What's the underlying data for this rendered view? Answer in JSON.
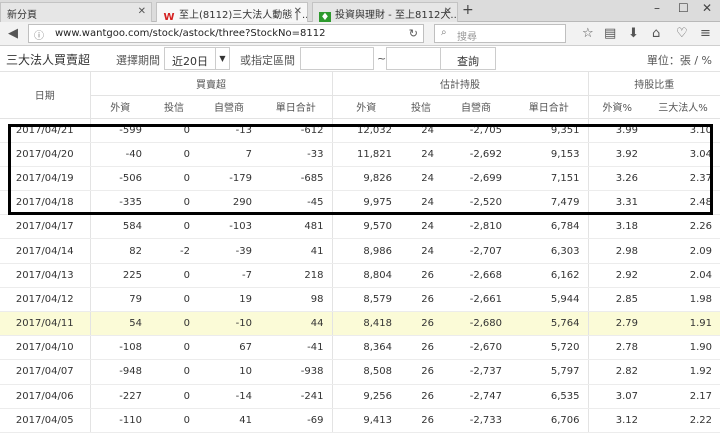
{
  "browser": {
    "tabs": [
      {
        "title": "新分頁",
        "active": false
      },
      {
        "title": "至上(8112)三大法人動態 | ...",
        "active": true
      },
      {
        "title": "投資與理財 - 至上8112大...",
        "active": false
      }
    ],
    "new_tab": "+",
    "url": "www.wantgoo.com/stock/astock/three?StockNo=8112",
    "search_placeholder": "搜尋"
  },
  "filter": {
    "page_title": "三大法人買賣超",
    "period_label": "選擇期間",
    "period_value": "近20日",
    "range_label": "或指定區間",
    "range_sep": "~",
    "query_button": "查詢",
    "unit": "單位：張 / %"
  },
  "table": {
    "date_header": "日期",
    "group_headers": [
      "買賣超",
      "估計持股",
      "持股比重"
    ],
    "sub_headers": [
      "外資",
      "投信",
      "自營商",
      "單日合計",
      "外資",
      "投信",
      "自營商",
      "單日合計",
      "外資%",
      "三大法人%"
    ],
    "rows": [
      {
        "date": "2017/04/21",
        "v": [
          "-599",
          "0",
          "-13",
          "-612",
          "12,032",
          "24",
          "-2,705",
          "9,351",
          "3.99",
          "3.10"
        ],
        "trend": "neg"
      },
      {
        "date": "2017/04/20",
        "v": [
          "-40",
          "0",
          "7",
          "-33",
          "11,821",
          "24",
          "-2,692",
          "9,153",
          "3.92",
          "3.04"
        ],
        "trend": "neg"
      },
      {
        "date": "2017/04/19",
        "v": [
          "-506",
          "0",
          "-179",
          "-685",
          "9,826",
          "24",
          "-2,699",
          "7,151",
          "3.26",
          "2.37"
        ],
        "trend": "neg"
      },
      {
        "date": "2017/04/18",
        "v": [
          "-335",
          "0",
          "290",
          "-45",
          "9,975",
          "24",
          "-2,520",
          "7,479",
          "3.31",
          "2.48"
        ],
        "trend": "neg"
      },
      {
        "date": "2017/04/17",
        "v": [
          "584",
          "0",
          "-103",
          "481",
          "9,570",
          "24",
          "-2,810",
          "6,784",
          "3.18",
          "2.26"
        ],
        "trend": "pos"
      },
      {
        "date": "2017/04/14",
        "v": [
          "82",
          "-2",
          "-39",
          "41",
          "8,986",
          "24",
          "-2,707",
          "6,303",
          "2.98",
          "2.09"
        ],
        "trend": "pos"
      },
      {
        "date": "2017/04/13",
        "v": [
          "225",
          "0",
          "-7",
          "218",
          "8,804",
          "26",
          "-2,668",
          "6,162",
          "2.92",
          "2.04"
        ],
        "trend": "pos"
      },
      {
        "date": "2017/04/12",
        "v": [
          "79",
          "0",
          "19",
          "98",
          "8,579",
          "26",
          "-2,661",
          "5,944",
          "2.85",
          "1.98"
        ],
        "trend": "pos"
      },
      {
        "date": "2017/04/11",
        "v": [
          "54",
          "0",
          "-10",
          "44",
          "8,418",
          "26",
          "-2,680",
          "5,764",
          "2.79",
          "1.91"
        ],
        "trend": "pos",
        "highlight": true
      },
      {
        "date": "2017/04/10",
        "v": [
          "-108",
          "0",
          "67",
          "-41",
          "8,364",
          "26",
          "-2,670",
          "5,720",
          "2.78",
          "1.90"
        ],
        "trend": "neg"
      },
      {
        "date": "2017/04/07",
        "v": [
          "-948",
          "0",
          "10",
          "-938",
          "8,508",
          "26",
          "-2,737",
          "5,797",
          "2.82",
          "1.92"
        ],
        "trend": "neg"
      },
      {
        "date": "2017/04/06",
        "v": [
          "-227",
          "0",
          "-14",
          "-241",
          "9,256",
          "26",
          "-2,747",
          "6,535",
          "3.07",
          "2.17"
        ],
        "trend": "neg"
      },
      {
        "date": "2017/04/05",
        "v": [
          "-110",
          "0",
          "41",
          "-69",
          "9,413",
          "26",
          "-2,733",
          "6,706",
          "3.12",
          "2.22"
        ],
        "trend": "neg"
      }
    ]
  },
  "colors": {
    "positive": "#b32020",
    "negative": "#2e8b2e",
    "highlight_row": "#fbfbd7"
  }
}
